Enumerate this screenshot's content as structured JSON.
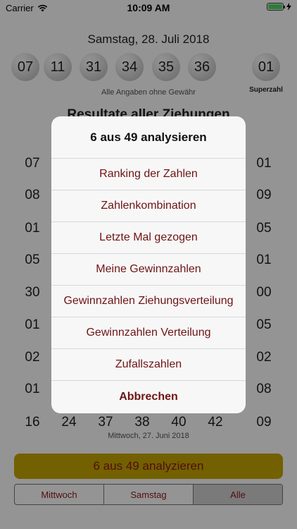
{
  "status_bar": {
    "carrier": "Carrier",
    "time": "10:09 AM"
  },
  "main": {
    "date": "Samstag, 28. Juli 2018",
    "numbers": [
      "07",
      "11",
      "31",
      "34",
      "35",
      "36"
    ],
    "superzahl_value": "01",
    "superzahl_label": "Superzahl",
    "disclaimer": "Alle Angaben ohne Gewähr",
    "results_title": "Resultate aller Ziehungen",
    "results": {
      "left_column": [
        "07",
        "08",
        "01",
        "05",
        "30",
        "01",
        "02",
        "01"
      ],
      "right_column": [
        "01",
        "09",
        "05",
        "01",
        "00",
        "05",
        "02",
        "08"
      ],
      "last_row": [
        "16",
        "24",
        "37",
        "38",
        "40",
        "42",
        "09"
      ],
      "last_row_date": "Mittwoch, 27. Juni 2018"
    },
    "analyze_button": "6 aus 49 analyzieren",
    "segments": [
      "Mittwoch",
      "Samstag",
      "Alle"
    ],
    "selected_segment": "Alle"
  },
  "action_sheet": {
    "title": "6 aus 49 analysieren",
    "items": [
      "Ranking der Zahlen",
      "Zahlenkombination",
      "Letzte Mal gezogen",
      "Meine Gewinnzahlen",
      "Gewinnzahlen Ziehungsverteilung",
      "Gewinnzahlen Verteilung",
      "Zufallszahlen"
    ],
    "cancel": "Abbrechen"
  },
  "colors": {
    "accent_text": "#8b1a1a",
    "analyze_button_bg": "#c7a500",
    "battery": "#4cd964"
  }
}
